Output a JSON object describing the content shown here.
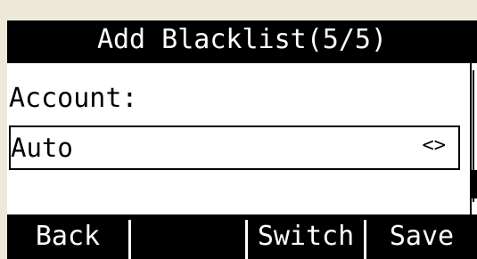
{
  "screen": {
    "title": "Add Blacklist(5/5)"
  },
  "form": {
    "account_label": "Account:",
    "account_value": "Auto",
    "arrows_glyph": "<>"
  },
  "softkeys": [
    {
      "label": "Back"
    },
    {
      "label": ""
    },
    {
      "label": "Switch"
    },
    {
      "label": "Save"
    }
  ]
}
